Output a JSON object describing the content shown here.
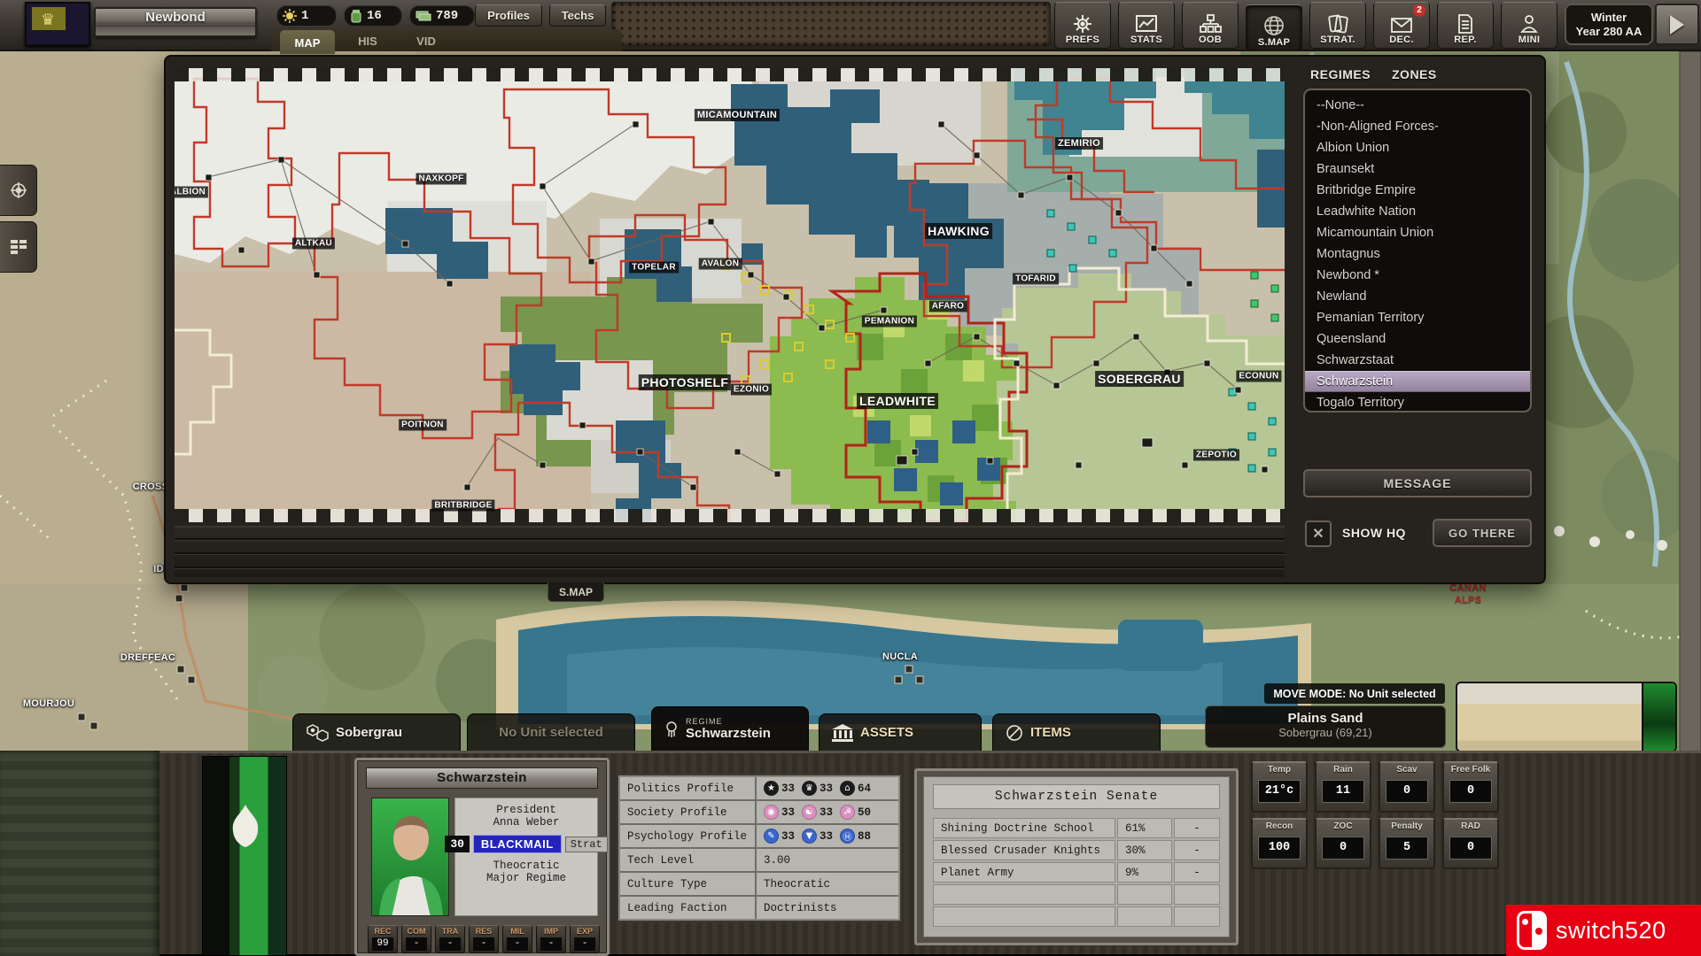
{
  "top_bar": {
    "regime_name": "Newbond",
    "resources": [
      {
        "icon": "sun-icon",
        "value": "1"
      },
      {
        "icon": "flask-icon",
        "value": "16"
      },
      {
        "icon": "credits-icon",
        "value": "789"
      }
    ],
    "profiles_label": "Profiles",
    "techs_label": "Techs",
    "map_tabs": [
      {
        "label": "MAP"
      },
      {
        "label": "HIS"
      },
      {
        "label": "VID"
      }
    ],
    "buttons": [
      {
        "label": "PREFS",
        "icon": "gear-icon"
      },
      {
        "label": "STATS",
        "icon": "chart-icon"
      },
      {
        "label": "OOB",
        "icon": "org-chart-icon"
      },
      {
        "label": "S.MAP",
        "icon": "globe-icon"
      },
      {
        "label": "STRAT.",
        "icon": "cards-icon"
      },
      {
        "label": "DEC.",
        "icon": "envelope-icon",
        "badge": "2"
      },
      {
        "label": "REP.",
        "icon": "report-icon"
      },
      {
        "label": "MINI",
        "icon": "person-icon"
      }
    ],
    "turn": {
      "season": "Winter",
      "year": "Year 280 AA"
    }
  },
  "smap": {
    "tab_label": "S.MAP",
    "window_tabs": [
      {
        "label": "REGIMES"
      },
      {
        "label": "ZONES"
      }
    ],
    "regime_items": [
      "--None--",
      "-Non-Aligned Forces-",
      "Albion Union",
      "Braunsekt",
      "Britbridge Empire",
      "Leadwhite Nation",
      "Micamountain Union",
      "Montagnus",
      "Newbond *",
      "Newland",
      "Pemanian Territory",
      "Queensland",
      "Schwarzstaat",
      "Schwarzstein",
      "Togalo Territory"
    ],
    "selected_regime": "Schwarzstein",
    "message_label": "MESSAGE",
    "show_hq_label": "SHOW HQ",
    "go_there_label": "GO THERE",
    "map_labels": [
      {
        "text": "ALBION"
      },
      {
        "text": "ALTKAU"
      },
      {
        "text": "NAXKOPF"
      },
      {
        "text": "MICAMOUNTAIN"
      },
      {
        "text": "ZEMIRIO"
      },
      {
        "text": "HAWKING"
      },
      {
        "text": "TOFARID"
      },
      {
        "text": "TOPELAR"
      },
      {
        "text": "AVALON"
      },
      {
        "text": "PEMANION"
      },
      {
        "text": "AFARO"
      },
      {
        "text": "PHOTOSHELF"
      },
      {
        "text": "EZONIO"
      },
      {
        "text": "LEADWHITE"
      },
      {
        "text": "SOBERGRAU"
      },
      {
        "text": "ECONUN"
      },
      {
        "text": "ZEPOTIO"
      },
      {
        "text": "POITNON"
      },
      {
        "text": "BRITBRIDGE"
      }
    ]
  },
  "bg_map": {
    "labels": [
      {
        "text": "CROSS"
      },
      {
        "text": "IDEN"
      },
      {
        "text": "DREFFEAC"
      },
      {
        "text": "MOURJOU"
      },
      {
        "text": "NUCLA"
      },
      {
        "text": "CANAN"
      },
      {
        "text": "ALPS"
      }
    ]
  },
  "bottom_tabs": [
    {
      "label": "Sobergrau",
      "icon": "hex-cluster-icon"
    },
    {
      "label": "No Unit selected"
    },
    {
      "label": "Schwarzstein",
      "category": "REGIME",
      "icon": "fist-icon"
    },
    {
      "label": "ASSETS",
      "icon": "bank-icon"
    },
    {
      "label": "ITEMS",
      "icon": "items-icon"
    }
  ],
  "move_mode": {
    "banner": "MOVE MODE: No Unit selected",
    "terrain": "Plains Sand",
    "location": "Sobergrau (69,21)"
  },
  "regime_panel": {
    "title": "Schwarzstein",
    "leader_title": "President",
    "leader_name": "Anna Weber",
    "stat_value": "30",
    "action_label": "BLACKMAIL",
    "strat_label": "Strat",
    "gov_type": "Theocratic",
    "regime_size": "Major Regime",
    "buttons": [
      {
        "label": "REC",
        "value": "99"
      },
      {
        "label": "COM",
        "value": "-"
      },
      {
        "label": "TRA",
        "value": "-"
      },
      {
        "label": "RES",
        "value": "-"
      },
      {
        "label": "MIL",
        "value": "-"
      },
      {
        "label": "IMP",
        "value": "-"
      },
      {
        "label": "EXP",
        "value": "-"
      }
    ]
  },
  "profile_table": {
    "rows": [
      {
        "label": "Politics Profile",
        "stats": [
          {
            "icon": "star-icon",
            "glyph": "★",
            "value": "33"
          },
          {
            "icon": "crown-icon",
            "glyph": "♛",
            "value": "33"
          },
          {
            "icon": "temple-icon",
            "glyph": "⌂",
            "value": "64"
          }
        ]
      },
      {
        "label": "Society Profile",
        "stats": [
          {
            "icon": "eye-icon",
            "glyph": "◉",
            "value": "33"
          },
          {
            "icon": "masks-icon",
            "glyph": "☯",
            "value": "33"
          },
          {
            "icon": "labor-icon",
            "glyph": "☭",
            "value": "50"
          }
        ]
      },
      {
        "label": "Psychology Profile",
        "stats": [
          {
            "icon": "pencil-icon",
            "glyph": "✎",
            "value": "33"
          },
          {
            "icon": "education-icon",
            "glyph": "▼",
            "value": "33"
          },
          {
            "icon": "humanity-icon",
            "glyph": "Ⓗ",
            "value": "88"
          }
        ]
      },
      {
        "label": "Tech Level",
        "value": "3.00"
      },
      {
        "label": "Culture Type",
        "value": "Theocratic"
      },
      {
        "label": "Leading Faction",
        "value": "Doctrinists"
      }
    ]
  },
  "senate": {
    "title": "Schwarzstein Senate",
    "rows": [
      {
        "name": "Shining Doctrine School",
        "share": "61%",
        "col3": "-"
      },
      {
        "name": "Blessed Crusader Knights",
        "share": "30%",
        "col3": "-"
      },
      {
        "name": "Planet Army",
        "share": "9%",
        "col3": "-"
      }
    ]
  },
  "hex_stats": {
    "cells": [
      {
        "label": "Temp",
        "value": "21°c"
      },
      {
        "label": "Rain",
        "value": "11"
      },
      {
        "label": "Scav",
        "value": "0"
      },
      {
        "label": "Free Folk",
        "value": "0"
      },
      {
        "label": "Recon",
        "value": "100"
      },
      {
        "label": "ZOC",
        "value": "0"
      },
      {
        "label": "Penalty",
        "value": "5"
      },
      {
        "label": "RAD",
        "value": "0"
      }
    ]
  },
  "watermark": {
    "text": "switch520"
  },
  "colors": {
    "accent_red_border": "#c03a28",
    "selected_row": "#a998b8",
    "blackmail_blue": "#2424bc",
    "watermark_red": "#e60012"
  }
}
